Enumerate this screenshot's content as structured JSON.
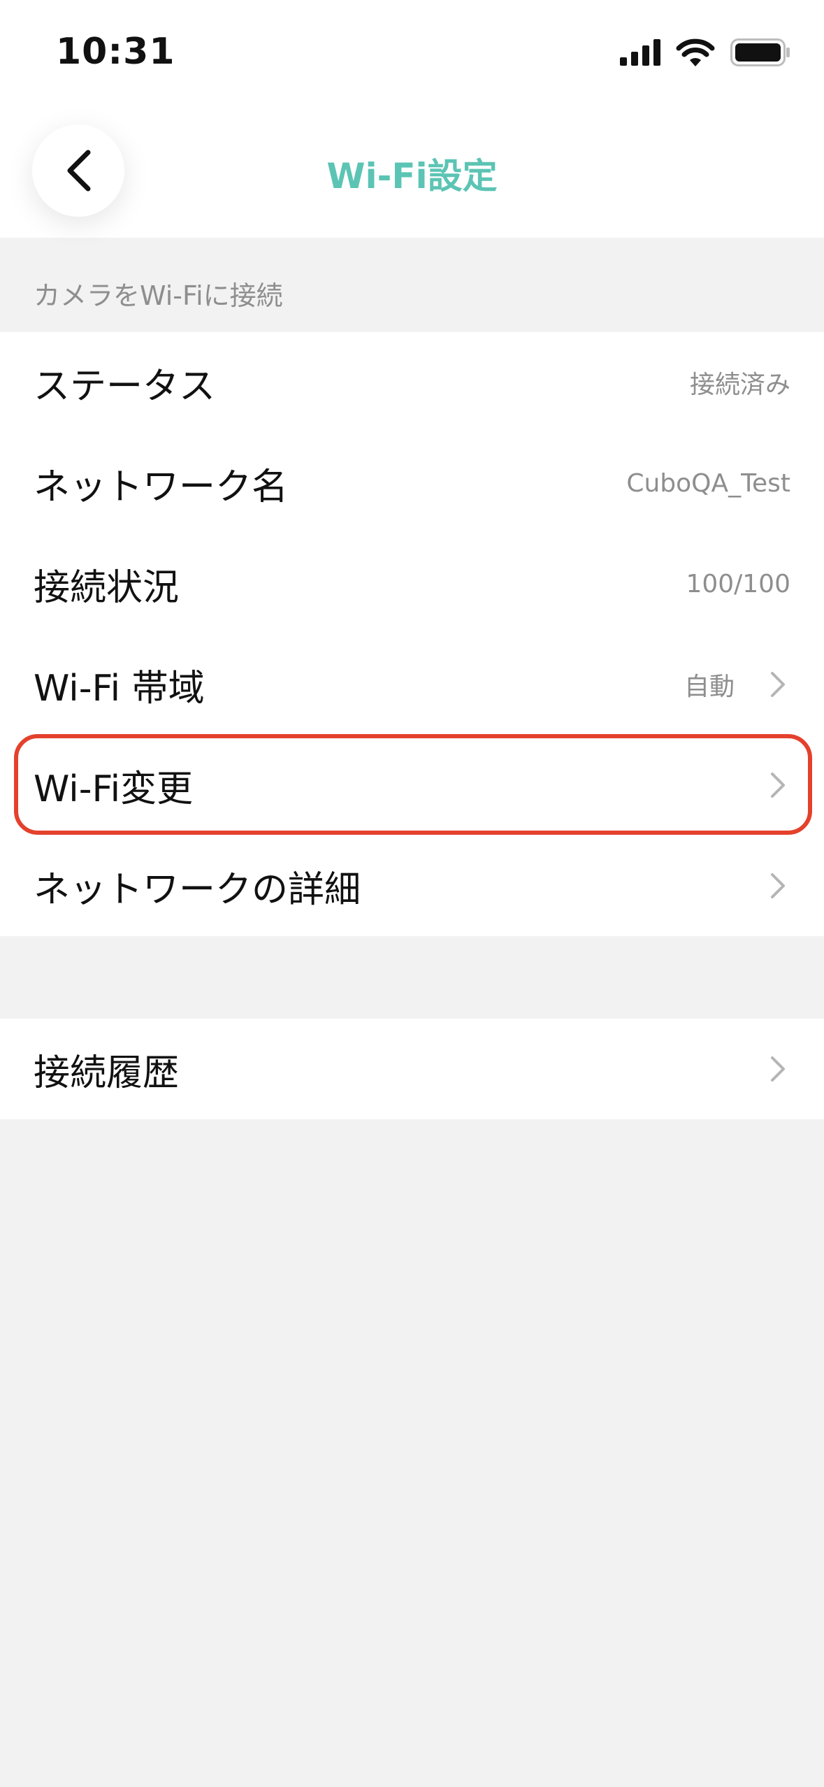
{
  "status_bar": {
    "time": "10:31",
    "icons": [
      "cellular-signal-icon",
      "wifi-icon",
      "battery-icon"
    ]
  },
  "header": {
    "back_icon": "chevron-left-icon",
    "title": "Wi-Fi設定"
  },
  "section": {
    "caption": "カメラをWi-Fiに接続"
  },
  "wifi_group": {
    "items": [
      {
        "label": "ステータス",
        "value": "接続済み"
      },
      {
        "label": "ネットワーク名",
        "value": "CuboQA_Test"
      },
      {
        "label": "接続状況",
        "value": "100/100"
      },
      {
        "label": "Wi-Fi 帯域",
        "value": "自動"
      },
      {
        "label": "Wi-Fi変更"
      },
      {
        "label": "ネットワークの詳細"
      }
    ]
  },
  "history_group": {
    "items": [
      {
        "label": "接続履歴"
      }
    ]
  },
  "colors": {
    "accent": "#5cc4b4",
    "highlight": "#e4412d",
    "background": "#f2f2f2",
    "secondary_text": "#8e8e8e"
  }
}
